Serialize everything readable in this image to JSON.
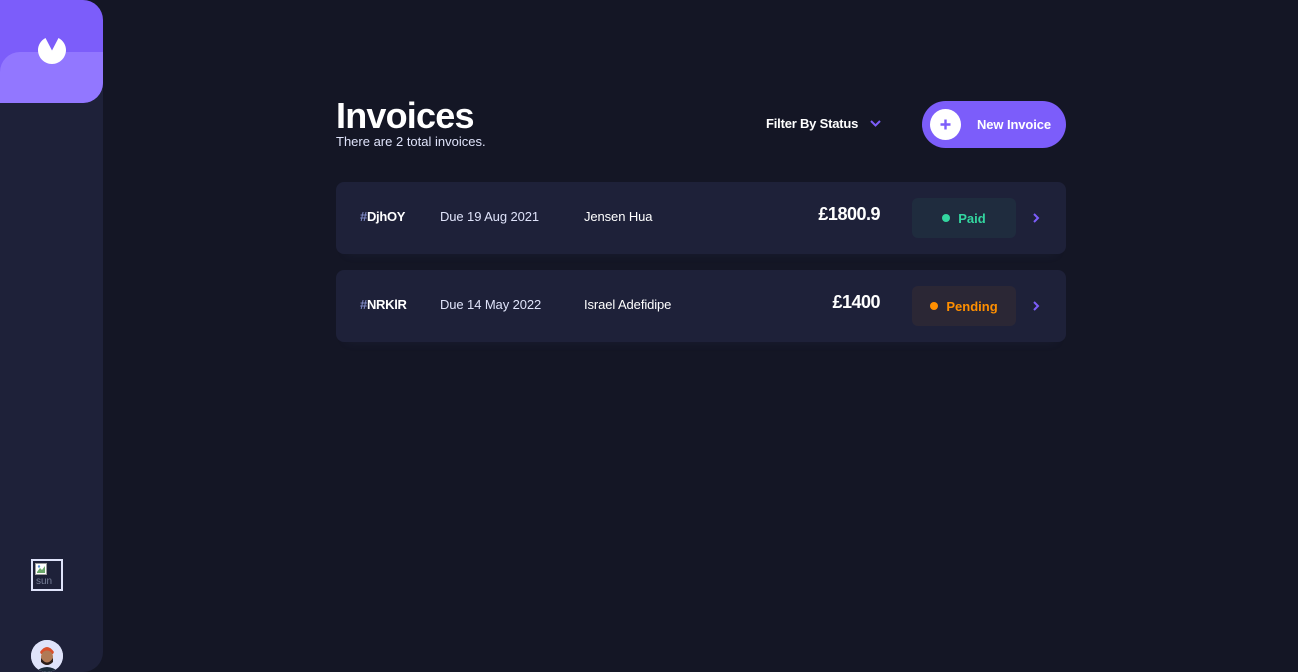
{
  "sidebar": {
    "logo_icon": "brand-logo-icon",
    "theme_toggle": {
      "icon": "broken-image-icon",
      "alt_text": "sun"
    },
    "avatar_icon": "user-avatar"
  },
  "header": {
    "title": "Invoices",
    "subtitle": "There are 2 total invoices.",
    "filter_label": "Filter By Status",
    "filter_icon": "chevron-down-icon",
    "new_invoice_label": "New Invoice",
    "new_invoice_icon": "plus-icon"
  },
  "invoices": [
    {
      "id_prefix": "#",
      "id": "DjhOY",
      "due": "Due 19 Aug 2021",
      "client": "Jensen Hua",
      "amount": "£1800.9",
      "status": "Paid"
    },
    {
      "id_prefix": "#",
      "id": "NRKlR",
      "due": "Due 14 May 2022",
      "client": "Israel Adefidipe",
      "amount": "£1400",
      "status": "Pending"
    }
  ],
  "colors": {
    "background": "#141625",
    "surface": "#1e2139",
    "accent": "#7c5dfa",
    "accent_light": "#9277ff",
    "paid": "#33d69f",
    "pending": "#ff8f00"
  }
}
